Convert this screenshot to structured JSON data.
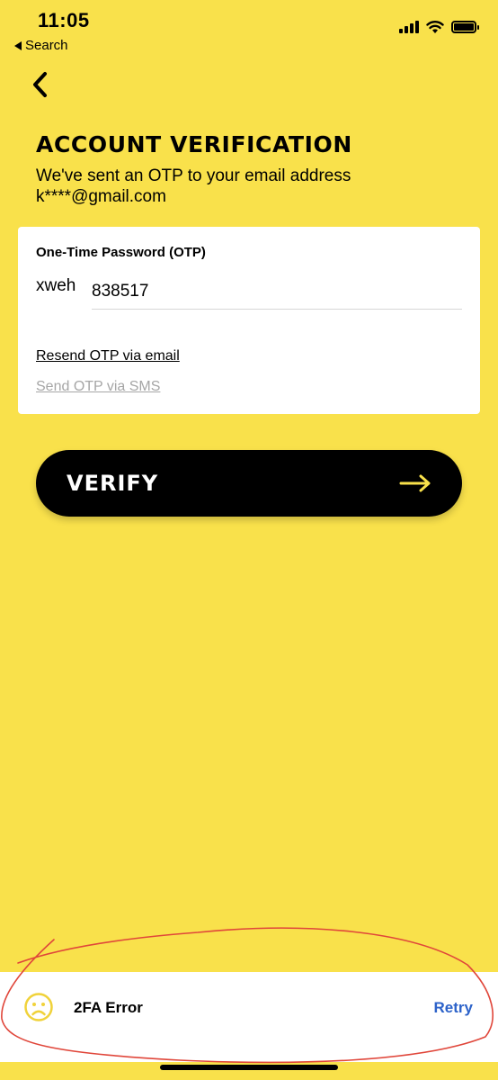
{
  "status_bar": {
    "time": "11:05",
    "back_label": "Search",
    "icons": [
      "signal-icon",
      "wifi-icon",
      "battery-icon"
    ]
  },
  "header": {
    "back_icon": "chevron-left-icon",
    "title": "ACCOUNT VERIFICATION",
    "subtitle_line1": "We've sent an OTP to your email address",
    "subtitle_line2": "k****@gmail.com"
  },
  "otp_card": {
    "label": "One-Time Password (OTP)",
    "prefix": "xweh",
    "value": "838517",
    "resend_link": "Resend OTP via email",
    "sms_link": "Send OTP via SMS"
  },
  "verify_button": {
    "label": "VERIFY",
    "icon": "arrow-right-icon"
  },
  "toast": {
    "icon": "sad-face-icon",
    "message": "2FA Error",
    "action": "Retry"
  },
  "colors": {
    "background": "#f9e14b",
    "accent_yellow": "#f9e14b",
    "button": "#000000",
    "link_blue": "#2c62c9",
    "muted_link": "#a6a6a6",
    "annotation_red": "#e0463a"
  }
}
